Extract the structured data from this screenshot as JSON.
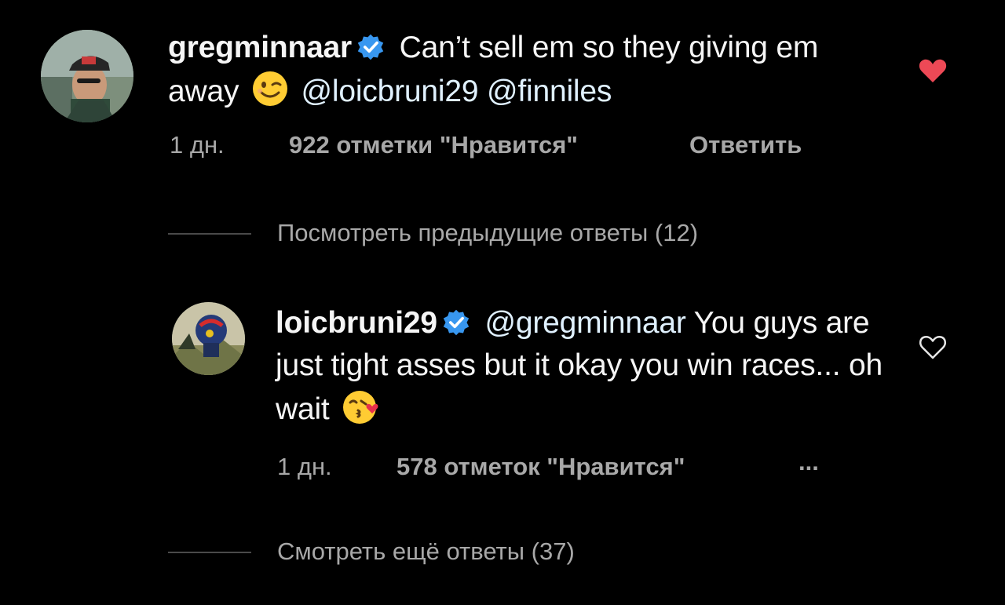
{
  "main_comment": {
    "username": "gregminnaar",
    "text": "Can’t sell em so they giving em away",
    "emoji": "winking-face-emoji",
    "mentions": [
      "@loicbruni29",
      "@finniles"
    ],
    "time": "1 дн.",
    "likes": "922 отметки \"Нравится\"",
    "reply_label": "Ответить",
    "liked": true
  },
  "view_previous_replies": "Посмотреть предыдущие ответы (12)",
  "reply_comment": {
    "username": "loicbruni29",
    "mention": "@gregminnaar",
    "text": "You guys are just tight asses but it okay you win races... oh wait",
    "emoji": "face-blowing-kiss-emoji",
    "time": "1 дн.",
    "likes": "578 отметок \"Нравится\"",
    "more_label": "...",
    "liked": false
  },
  "view_more_replies": "Смотреть ещё ответы (37)",
  "colors": {
    "background": "#000000",
    "text": "#f5f5f5",
    "secondary": "#a8a8a8",
    "verified_blue": "#3897f0",
    "like_red": "#ed4956",
    "mention": "#e0f1ff"
  }
}
